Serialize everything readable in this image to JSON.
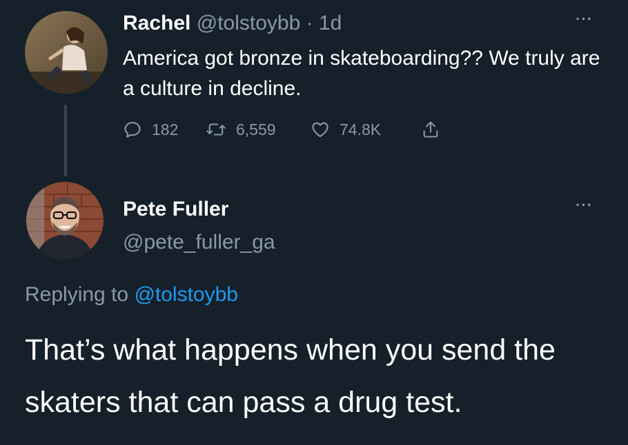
{
  "tweet1": {
    "author_name": "Rachel",
    "author_handle": "@tolstoybb",
    "time": " · 1d",
    "text": "America got bronze in skateboarding?? We truly are a culture in decline.",
    "more_icon": "more-dots-icon",
    "actions": {
      "reply_count": "182",
      "retweet_count": "6,559",
      "like_count": "74.8K"
    }
  },
  "tweet2": {
    "author_name": "Pete Fuller",
    "author_handle": "@pete_fuller_ga",
    "replying_prefix": "Replying to ",
    "replying_mention": "@tolstoybb",
    "text": "That’s what happens when you send the skaters that can pass a drug test.",
    "more_icon": "more-dots-icon"
  },
  "theme": {
    "background": "#15202b",
    "text_primary": "#ffffff",
    "text_secondary": "#8b98a5",
    "accent": "#1d9bf0",
    "thread_line": "#38444d"
  }
}
